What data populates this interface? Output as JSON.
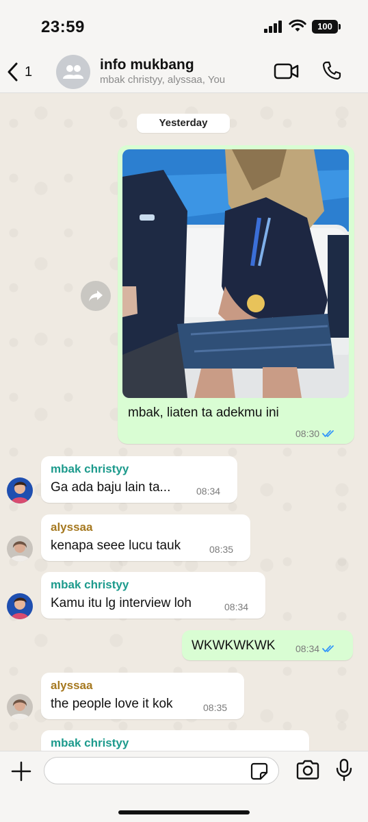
{
  "status_bar": {
    "time": "23:59",
    "battery": "100"
  },
  "header": {
    "back_count": "1",
    "group_name": "info mukbang",
    "members": "mbak christyy, alyssaa, You"
  },
  "date_chip": "Yesterday",
  "messages": [
    {
      "type": "out-image",
      "caption": "mbak, liaten ta adekmu ini",
      "time": "08:30",
      "ticks": "read"
    },
    {
      "type": "in",
      "sender": "mbak christyy",
      "text": "Ga ada baju lain ta...",
      "time": "08:34"
    },
    {
      "type": "in",
      "sender": "alyssaa",
      "text": "kenapa seee lucu tauk",
      "time": "08:35"
    },
    {
      "type": "in",
      "sender": "mbak christyy",
      "text": "Kamu itu lg interview loh",
      "time": "08:34"
    },
    {
      "type": "out",
      "text": "WKWKWKWK",
      "time": "08:34",
      "ticks": "read"
    },
    {
      "type": "in",
      "sender": "alyssaa",
      "text": "the people love it kok",
      "time": "08:35"
    },
    {
      "type": "in",
      "sender": "mbak christyy",
      "text": ""
    }
  ],
  "colors": {
    "sender_christyy": "#1c9a8c",
    "sender_alyssaa": "#a5781f",
    "outgoing_bubble": "#d9fdd3",
    "read_ticks": "#3497f9"
  },
  "input": {
    "placeholder": ""
  },
  "icons": {
    "back": "chevron-left-icon",
    "video": "video-camera-icon",
    "call": "phone-icon",
    "forward": "forward-arrow-icon",
    "plus": "plus-icon",
    "sticker": "sticker-icon",
    "camera": "camera-icon",
    "mic": "microphone-icon"
  }
}
